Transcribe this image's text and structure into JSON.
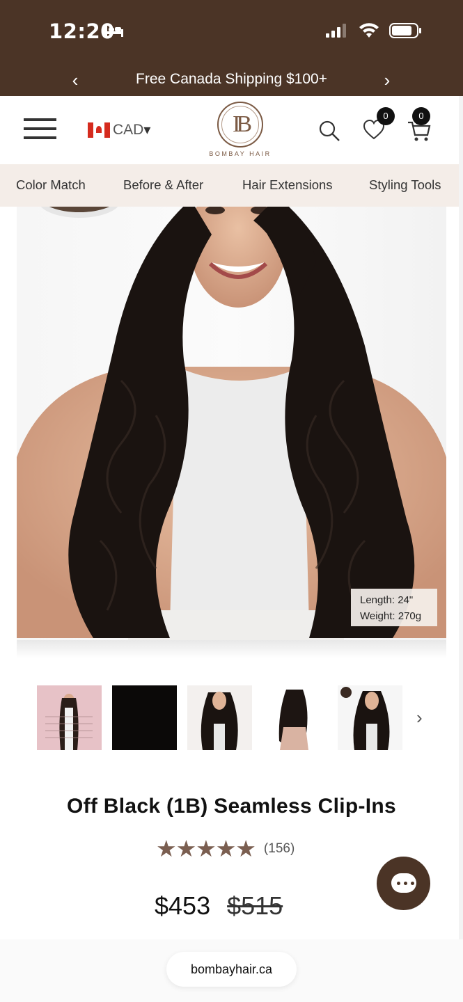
{
  "status_bar": {
    "time": "12:20",
    "battery_icon": "battery-icon",
    "wifi_icon": "wifi-icon",
    "signal_icon": "cellular-signal-icon",
    "bed_icon": "sleep-focus-icon"
  },
  "promo": {
    "text": "Free Canada Shipping $100+",
    "prev": "‹",
    "next": "›"
  },
  "header": {
    "currency": "CAD",
    "currency_caret": "▾",
    "logo_monogram": "IB",
    "logo_text": "BOMBAY HAIR",
    "wishlist_count": "0",
    "cart_count": "0"
  },
  "nav": {
    "items": [
      "Color Match",
      "Before & After",
      "Hair Extensions",
      "Styling Tools"
    ]
  },
  "hero": {
    "spec_length": "Length: 24\"",
    "spec_weight": "Weight: 270g"
  },
  "thumbnails": {
    "next": "›"
  },
  "product": {
    "title": "Off Black (1B) Seamless Clip-Ins",
    "stars": "★★★★★",
    "rating": 5,
    "reviews": "(156)",
    "price": "$453",
    "compare_price": "$515"
  },
  "browser": {
    "url": "bombayhair.ca"
  },
  "colors": {
    "brand_brown": "#4b3426",
    "star_color": "#7a5e50",
    "nav_bg": "#f4ede8"
  }
}
